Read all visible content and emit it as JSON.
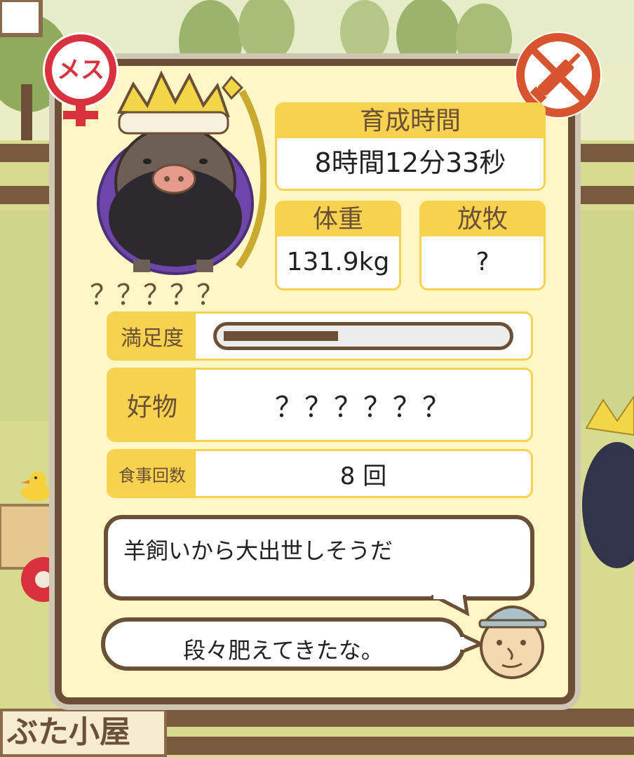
{
  "profile": {
    "gender_label": "メス",
    "name_unknown": "？？？？？"
  },
  "stats": {
    "time_label": "育成時間",
    "time_value": "8時間12分33秒",
    "weight_label": "体重",
    "weight_value": "131.9kg",
    "pasture_label": "放牧",
    "pasture_value": "?",
    "satisfaction_label": "満足度",
    "satisfaction_fraction": 0.41,
    "favorite_label": "好物",
    "favorite_value": "？？？？？？",
    "meals_label": "食事回数",
    "meals_value": "8 回"
  },
  "speech": {
    "description": "羊飼いから大出世しそうだ",
    "farmer_comment": "段々肥えてきたな。"
  },
  "background": {
    "sign_label": "ぶた小屋"
  },
  "colors": {
    "card_bg": "#fdf7c6",
    "frame_brown": "#6b4f36",
    "header_yellow": "#f6d24f",
    "female_red": "#d9323e",
    "syringe_red": "#d8542f"
  },
  "icons": [
    "female-icon",
    "no-syringe-icon",
    "pig-king-avatar",
    "farmer-face-icon",
    "duck-icon"
  ]
}
